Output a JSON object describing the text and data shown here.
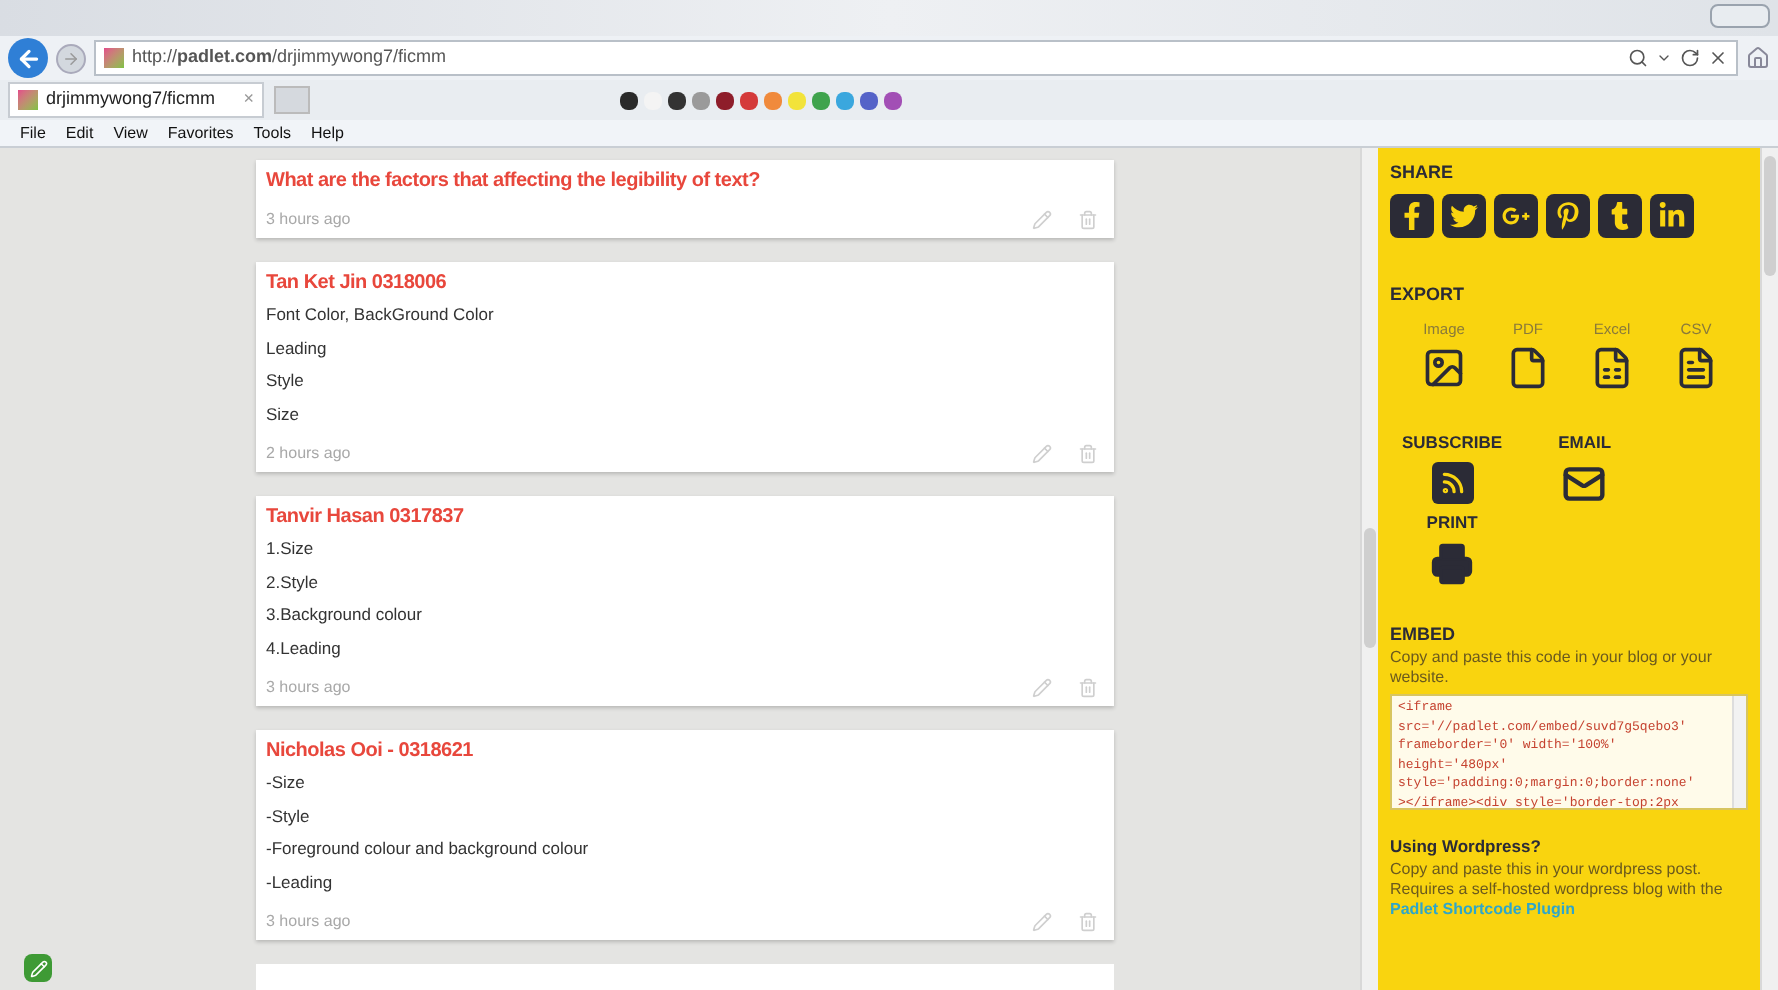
{
  "browser": {
    "address": "http://**padlet.com**/drjimmywong7/ficmm",
    "tab": {
      "label": "drjimmywong7/ficmm",
      "close": "×",
      "selected": true
    },
    "swatches": [
      {
        "color": "#2a2a2a"
      },
      {
        "color": "#f4f4f4"
      },
      {
        "color": "#333333"
      },
      {
        "color": "#9a9a9a"
      },
      {
        "color": "#8e1d2a"
      },
      {
        "color": "#d43a3a"
      },
      {
        "color": "#f08a3c"
      },
      {
        "color": "#f2e33a"
      },
      {
        "color": "#3fa34d"
      },
      {
        "color": "#3aa7de"
      },
      {
        "color": "#5563c8"
      },
      {
        "color": "#a24fb5"
      }
    ],
    "menu": [
      "File",
      "Edit",
      "View",
      "Favorites",
      "Tools",
      "Help"
    ]
  },
  "posts": [
    {
      "title": "What are the factors that affecting the legibility of text?",
      "time": "3 hours ago"
    },
    {
      "title": "Tan Ket Jin 0318006",
      "lines": [
        "Font Color, BackGround Color",
        "Leading",
        "Style",
        "Size"
      ],
      "time": "2 hours ago"
    },
    {
      "title": "Tanvir Hasan 0317837",
      "lines": [
        "1.Size",
        "2.Style",
        "3.Background colour",
        "4.Leading"
      ],
      "time": "3 hours ago"
    },
    {
      "title": "Nicholas Ooi - 0318621",
      "lines": [
        "-Size",
        "-Style",
        "-Foreground colour and background colour",
        "-Leading"
      ],
      "time": "3 hours ago"
    }
  ],
  "sidebar": {
    "share": {
      "heading": "SHARE",
      "items": [
        {
          "kind": "facebook"
        },
        {
          "kind": "twitter"
        },
        {
          "kind": "googleplus"
        },
        {
          "kind": "pinterest"
        },
        {
          "kind": "tumblr"
        },
        {
          "kind": "linkedin"
        }
      ]
    },
    "export": {
      "heading": "EXPORT",
      "items": [
        {
          "label": "Image",
          "kind": "image"
        },
        {
          "label": "PDF",
          "kind": "pdf"
        },
        {
          "label": "Excel",
          "kind": "excel"
        },
        {
          "label": "CSV",
          "kind": "csv"
        }
      ]
    },
    "subscribe": "SUBSCRIBE",
    "email": "EMAIL",
    "print": "PRINT",
    "embed": {
      "heading": "EMBED",
      "text": "Copy and paste this code in your blog or your website.",
      "code": [
        "<iframe",
        "src='//padlet.com/embed/suvd7g5qebo3'",
        "frameborder='0' width='100%'",
        "height='480px'",
        "style='padding:0;margin:0;border:none'",
        "></iframe><div style='border-top:2px"
      ]
    },
    "wordpress": {
      "heading": "Using Wordpress?",
      "text": "Copy and paste this in your wordpress post. Requires a self-hosted wordpress blog with the",
      "link": "Padlet Shortcode Plugin"
    }
  }
}
